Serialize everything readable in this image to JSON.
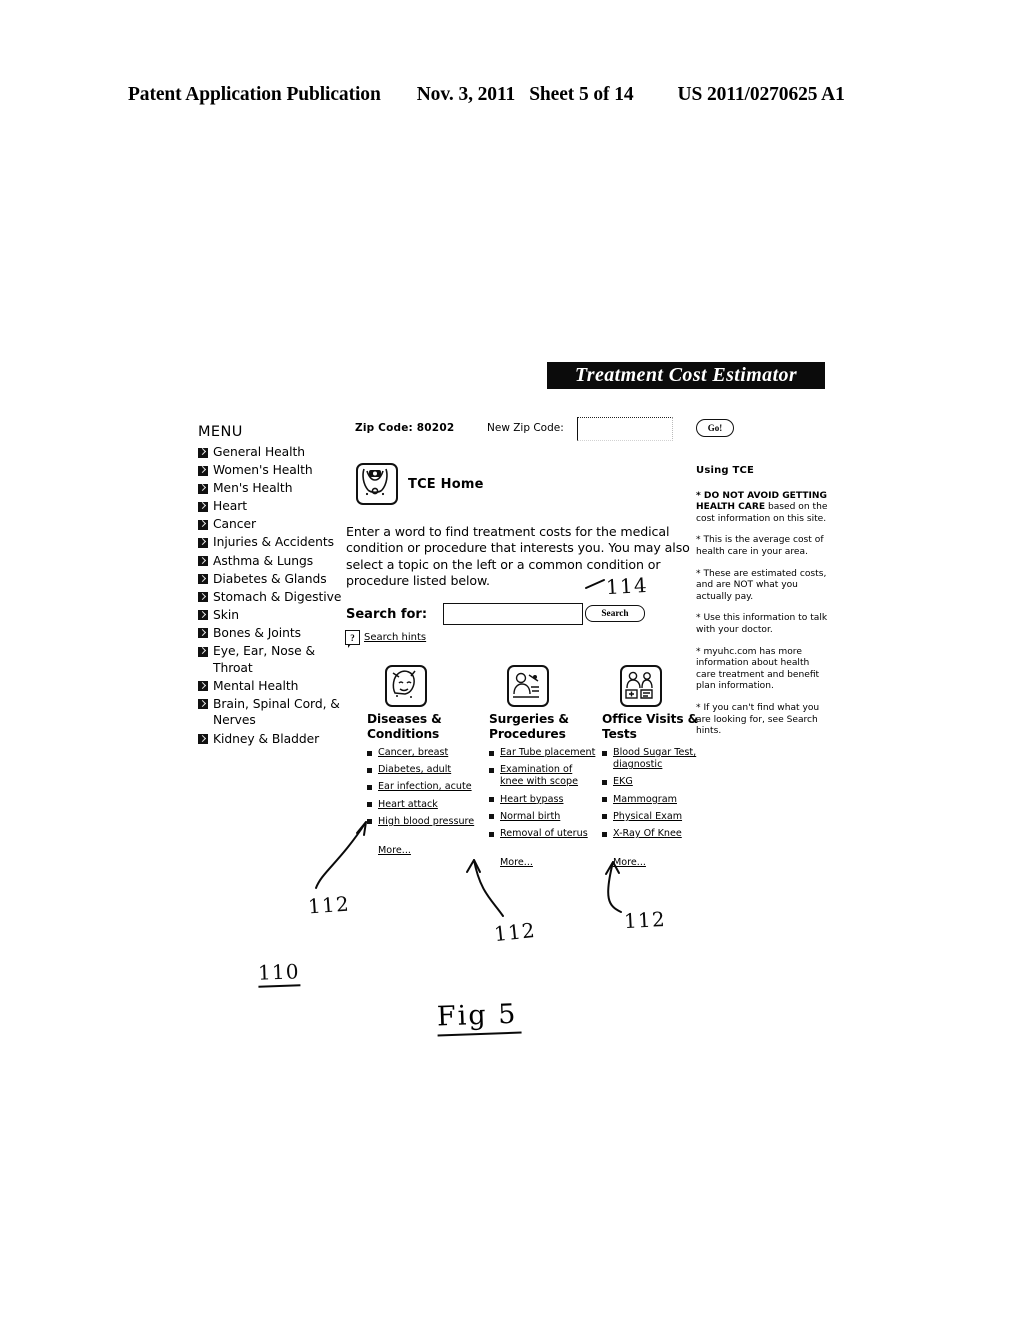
{
  "patent_header": {
    "publication": "Patent Application Publication",
    "date": "Nov. 3, 2011",
    "sheet": "Sheet 5 of 14",
    "number": "US 2011/0270625 A1"
  },
  "app": {
    "title": "Treatment Cost Estimator"
  },
  "zip_bar": {
    "current_zip_label": "Zip Code: 80202",
    "new_zip_label": "New Zip Code:",
    "new_zip_value": "",
    "new_zip_placeholder": "",
    "go_label": "Go!"
  },
  "menu": {
    "title": "MENU",
    "items": [
      {
        "label": "General Health",
        "icon": "arrow-square-icon"
      },
      {
        "label": "Women's Health",
        "icon": "arrow-square-icon"
      },
      {
        "label": "Men's Health",
        "icon": "arrow-square-icon"
      },
      {
        "label": "Heart",
        "icon": "arrow-square-icon"
      },
      {
        "label": "Cancer",
        "icon": "arrow-square-icon"
      },
      {
        "label": "Injuries & Accidents",
        "icon": "arrow-square-icon"
      },
      {
        "label": "Asthma & Lungs",
        "icon": "arrow-square-icon"
      },
      {
        "label": "Diabetes & Glands",
        "icon": "arrow-square-icon"
      },
      {
        "label": "Stomach & Digestive",
        "icon": "arrow-square-icon"
      },
      {
        "label": "Skin",
        "icon": "arrow-square-icon"
      },
      {
        "label": "Bones & Joints",
        "icon": "arrow-square-icon"
      },
      {
        "label": "Eye, Ear, Nose & Throat",
        "icon": "arrow-square-icon"
      },
      {
        "label": "Mental Health",
        "icon": "arrow-square-icon"
      },
      {
        "label": "Brain, Spinal Cord, & Nerves",
        "icon": "arrow-square-icon"
      },
      {
        "label": "Kidney & Bladder",
        "icon": "arrow-square-icon"
      }
    ]
  },
  "main": {
    "home_label": "TCE Home",
    "home_icon": "stethoscope-icon",
    "intro": "Enter a word to find treatment costs for the medical condition or procedure that interests you. You may also select a topic on the left or a common condition or procedure listed below.",
    "search_label": "Search for:",
    "search_value": "",
    "search_placeholder": "",
    "search_button": "Search",
    "hint_icon": "question-mark-icon",
    "hints_link": "Search hints"
  },
  "notes": {
    "title": "Using TCE",
    "items": [
      {
        "strong": "* DO NOT AVOID GETTING HEALTH CARE",
        "rest": " based on the cost information on this site."
      },
      {
        "strong": "",
        "rest": "* This is the average cost of health care in your area."
      },
      {
        "strong": "",
        "rest": "* These are estimated costs, and are NOT what you actually pay."
      },
      {
        "strong": "",
        "rest": "* Use this information to talk with your doctor."
      },
      {
        "strong": "",
        "rest": "* myuhc.com has more information about health care treatment and benefit plan information."
      },
      {
        "strong": "",
        "rest": "* If you can't find what you are looking for, see Search hints."
      }
    ]
  },
  "categories": [
    {
      "title": "Diseases & Conditions",
      "icon": "face-illustration-icon",
      "links": [
        "Cancer, breast",
        "Diabetes, adult",
        "Ear infection, acute",
        "Heart attack",
        "High blood pressure"
      ],
      "more": "More..."
    },
    {
      "title": "Surgeries & Procedures",
      "icon": "surgery-illustration-icon",
      "links": [
        "Ear Tube placement",
        "Examination of knee with scope",
        "Heart bypass",
        "Normal birth",
        "Removal of uterus"
      ],
      "more": "More..."
    },
    {
      "title": "Office Visits & Tests",
      "icon": "office-visit-illustration-icon",
      "links": [
        "Blood Sugar Test, diagnostic",
        "EKG",
        "Mammogram",
        "Physical Exam",
        "X-Ray Of Knee"
      ],
      "more": "More..."
    }
  ],
  "reference_numerals": {
    "search_area": "114",
    "category_a": "112",
    "category_b": "112",
    "category_c": "112",
    "screen": "110",
    "figure": "Fig 5"
  }
}
